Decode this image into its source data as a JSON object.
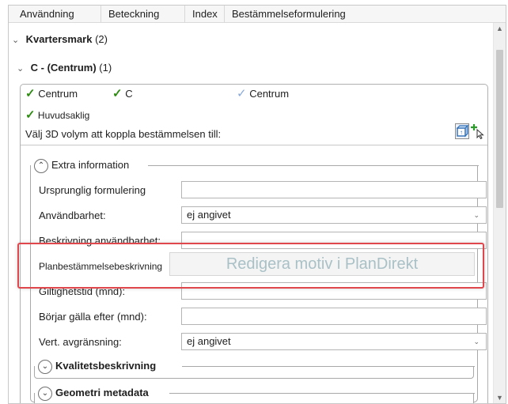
{
  "columns": {
    "usage": "Användning",
    "designation": "Beteckning",
    "index": "Index",
    "wording": "Bestämmelseformulering"
  },
  "groups": {
    "kvartersmark": {
      "label": "Kvartersmark",
      "count": "(2)"
    },
    "centrum": {
      "label": "C - (Centrum)",
      "count": "(1)"
    }
  },
  "panel": {
    "tag1": "Centrum",
    "tag2": "C",
    "tag3": "Centrum",
    "tag4": "Huvudsaklig",
    "volume_prompt": "Välj 3D volym att koppla bestämmelsen till:"
  },
  "extra": {
    "title": "Extra information",
    "original_wording_label": "Ursprunglig formulering",
    "original_wording_value": "",
    "usability_label": "Användbarhet:",
    "usability_value": "ej angivet",
    "usability_desc_label": "Beskrivning användbarhet:",
    "usability_desc_value": "",
    "plan_desc_label": "Planbestämmelsebeskrivning",
    "plan_desc_overlay": "Redigera motiv i PlanDirekt",
    "validity_label": "Giltighetstid (mnd):",
    "validity_value": "",
    "starts_label": "Börjar gälla efter (mnd):",
    "starts_value": "",
    "vert_label": "Vert. avgränsning:",
    "vert_value": "ej angivet"
  },
  "sections": {
    "quality": "Kvalitetsbeskrivning",
    "geometry": "Geometri metadata"
  },
  "icons": {
    "collapse": "chevron-down-icon",
    "check": "checkmark-icon",
    "expand_up": "circle-chevron-up-icon",
    "expand_down": "circle-chevron-down-icon"
  },
  "colors": {
    "check_green": "#2e8b12",
    "check_light": "#8aa9d9",
    "highlight": "#e0474c",
    "overlay_text": "#a9c1c6"
  }
}
